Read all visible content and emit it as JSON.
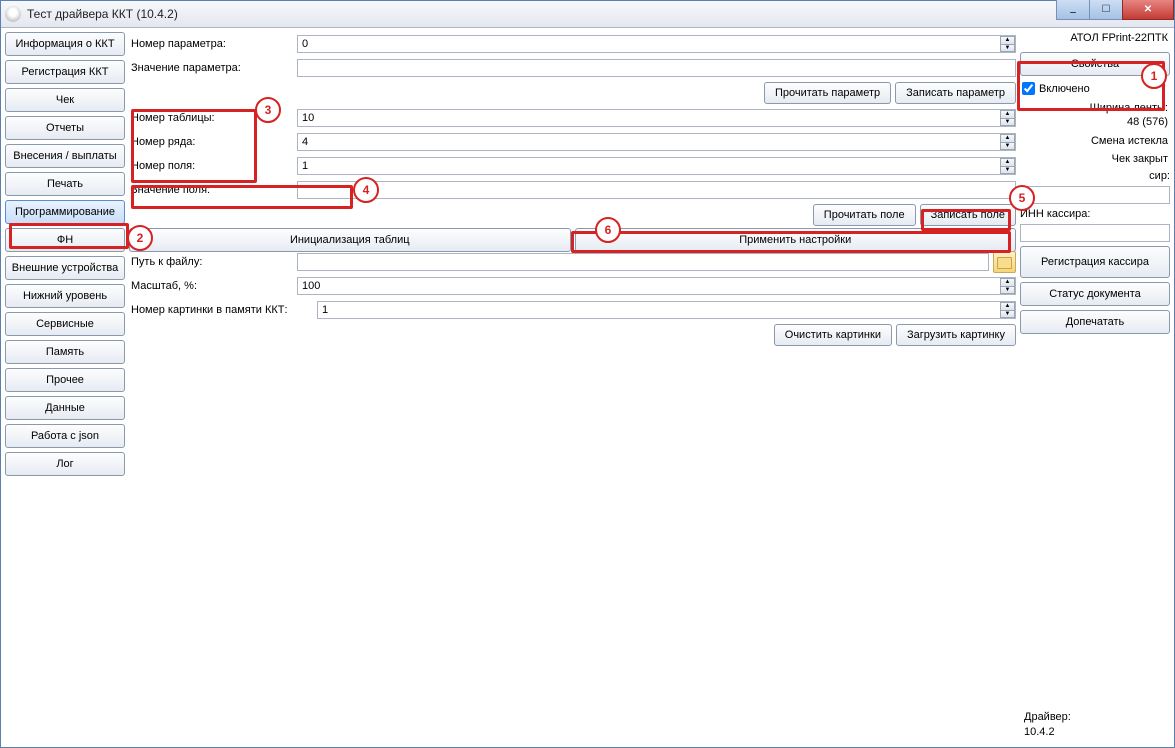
{
  "window": {
    "title": "Тест драйвера ККТ (10.4.2)"
  },
  "sidebar": {
    "items": [
      "Информация о ККТ",
      "Регистрация ККТ",
      "Чек",
      "Отчеты",
      "Внесения / выплаты",
      "Печать",
      "Программирование",
      "ФН",
      "Внешние устройства",
      "Нижний уровень",
      "Сервисные",
      "Память",
      "Прочее",
      "Данные",
      "Работа с json",
      "Лог"
    ],
    "active_index": 6
  },
  "main": {
    "param_number_label": "Номер параметра:",
    "param_number_value": "0",
    "param_value_label": "Значение параметра:",
    "param_value_value": "",
    "read_param_btn": "Прочитать параметр",
    "write_param_btn": "Записать параметр",
    "table_number_label": "Номер таблицы:",
    "table_number_value": "10",
    "row_number_label": "Номер ряда:",
    "row_number_value": "4",
    "field_number_label": "Номер поля:",
    "field_number_value": "1",
    "field_value_label": "Значение поля:",
    "field_value_value": "",
    "read_field_btn": "Прочитать поле",
    "write_field_btn": "Записать поле",
    "init_tables_btn": "Инициализация таблиц",
    "apply_settings_btn": "Применить настройки",
    "file_path_label": "Путь к файлу:",
    "file_path_value": "",
    "scale_label": "Масштаб, %:",
    "scale_value": "100",
    "image_num_label": "Номер картинки в памяти ККТ:",
    "image_num_value": "1",
    "clear_images_btn": "Очистить картинки",
    "load_image_btn": "Загрузить картинку"
  },
  "right": {
    "device": "АТОЛ FPrint-22ПТК",
    "properties_btn": "Свойства",
    "enabled_checkbox_label": "Включено",
    "enabled_checked": true,
    "tape_width_label": "Ширина ленты:",
    "tape_width_value": "48 (576)",
    "shift_status": "Смена истекла",
    "receipt_status": "Чек закрыт",
    "cashier_suffix": "сир:",
    "cashier_value": "",
    "cashier_inn_label": "ИНН кассира:",
    "cashier_inn_value": "",
    "register_cashier_btn": "Регистрация кассира",
    "doc_status_btn": "Статус документа",
    "reprint_btn": "Допечатать",
    "driver_label": "Драйвер:",
    "driver_version": "10.4.2"
  },
  "annotations": {
    "1": "1",
    "2": "2",
    "3": "3",
    "4": "4",
    "5": "5",
    "6": "6"
  }
}
